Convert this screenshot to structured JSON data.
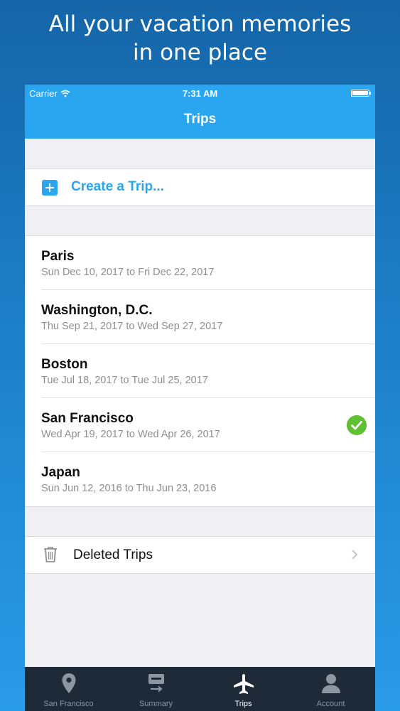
{
  "headline": {
    "line1": "All your vacation memories",
    "line2": "in one place"
  },
  "status": {
    "carrier": "Carrier",
    "time": "7:31 AM"
  },
  "nav": {
    "title": "Trips"
  },
  "create": {
    "label": "Create a Trip..."
  },
  "trips": [
    {
      "name": "Paris",
      "dates": "Sun Dec 10, 2017 to Fri Dec 22, 2017"
    },
    {
      "name": "Washington, D.C.",
      "dates": "Thu Sep 21, 2017 to Wed Sep 27, 2017"
    },
    {
      "name": "Boston",
      "dates": "Tue Jul 18, 2017 to Tue Jul 25, 2017"
    },
    {
      "name": "San Francisco",
      "dates": "Wed Apr 19, 2017 to Wed Apr 26, 2017",
      "selected": true
    },
    {
      "name": "Japan",
      "dates": "Sun Jun 12, 2016 to Thu Jun 23, 2016"
    }
  ],
  "deleted": {
    "label": "Deleted Trips"
  },
  "tabs": [
    {
      "label": "San Francisco",
      "icon": "map-pin-icon"
    },
    {
      "label": "Summary",
      "icon": "summary-icon"
    },
    {
      "label": "Trips",
      "icon": "airplane-icon",
      "active": true
    },
    {
      "label": "Account",
      "icon": "user-icon"
    }
  ],
  "colors": {
    "accent": "#2aa5f0",
    "check": "#5fc131",
    "tabbar": "#1e2a38"
  }
}
